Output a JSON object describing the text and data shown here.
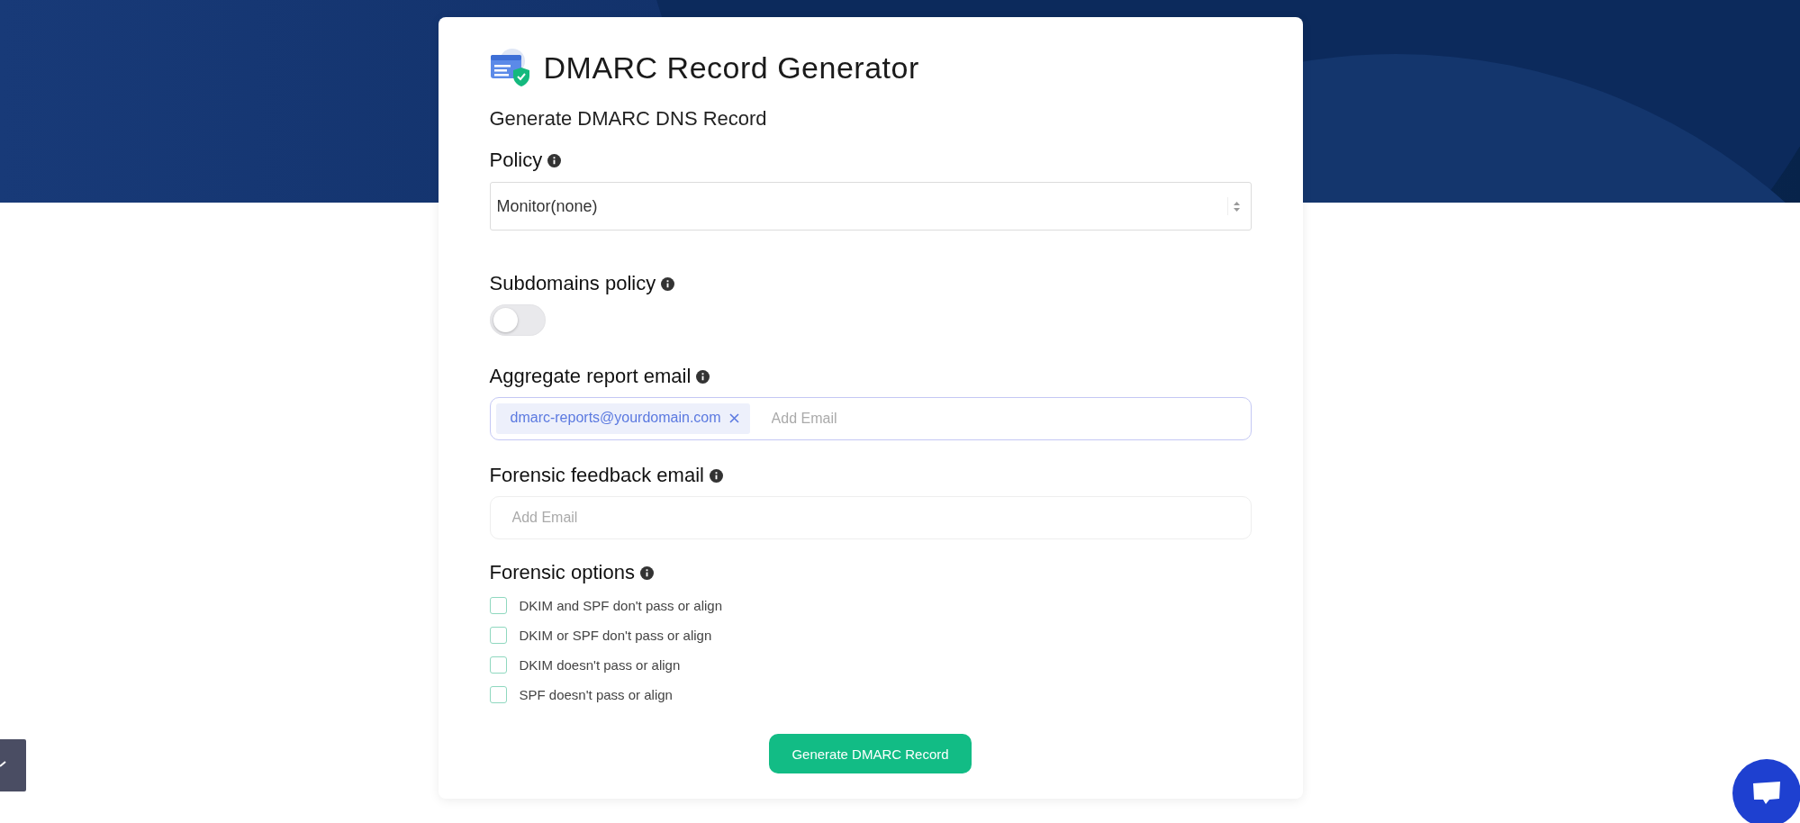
{
  "title": "DMARC Record Generator",
  "subtitle": "Generate DMARC DNS Record",
  "policy": {
    "label": "Policy",
    "value": "Monitor(none)"
  },
  "subdomains_policy": {
    "label": "Subdomains policy",
    "on": false
  },
  "aggregate_email": {
    "label": "Aggregate report email",
    "tags": [
      "dmarc-reports@yourdomain.com"
    ],
    "placeholder": "Add Email"
  },
  "forensic_email": {
    "label": "Forensic feedback email",
    "placeholder": "Add Email"
  },
  "forensic_options": {
    "label": "Forensic options",
    "options": [
      {
        "label": "DKIM and SPF don't pass or align",
        "checked": false
      },
      {
        "label": "DKIM or SPF don't pass or align",
        "checked": false
      },
      {
        "label": "DKIM doesn't pass or align",
        "checked": false
      },
      {
        "label": "SPF doesn't pass or align",
        "checked": false
      }
    ]
  },
  "submit_button": "Generate DMARC Record"
}
